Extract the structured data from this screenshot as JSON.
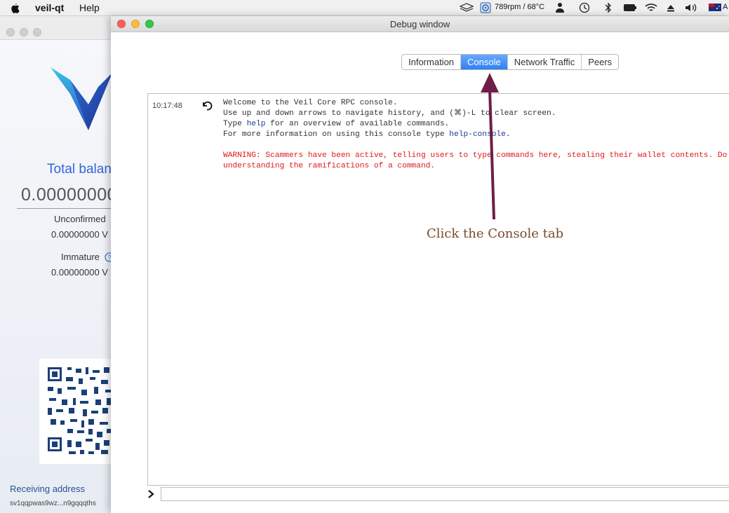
{
  "menubar": {
    "app_name": "veil-qt",
    "help": "Help",
    "cpu_status": "789rpm / 68°C",
    "locale": "A"
  },
  "wallet": {
    "total_label": "Total balan",
    "balance": "0.00000000",
    "unconfirmed_label": "Unconfirmed",
    "unconfirmed_value": "0.00000000 V",
    "immature_label": "Immature",
    "immature_value": "0.00000000 V",
    "receiving_label": "Receiving address",
    "address": "sv1qqpwas9wz...n9gqqqths"
  },
  "debug": {
    "title": "Debug window",
    "tabs": [
      {
        "label": "Information",
        "active": false
      },
      {
        "label": "Console",
        "active": true
      },
      {
        "label": "Network Traffic",
        "active": false
      },
      {
        "label": "Peers",
        "active": false
      }
    ],
    "console": {
      "time": "10:17:48",
      "line1": "Welcome to the Veil Core RPC console.",
      "line2": "Use up and down arrows to navigate history, and (⌘)-L to clear screen.",
      "line3_pre": "Type ",
      "line3_kw": "help",
      "line3_post": " for an overview of available commands.",
      "line4_pre": "For more information on using this console type ",
      "line4_kw": "help-console",
      "line4_post": ".",
      "warning1": "WARNING: Scammers have been active, telling users to type commands here, stealing their wallet contents. Do no",
      "warning2": "understanding the ramifications of a command."
    },
    "input": {
      "value": "",
      "placeholder": ""
    }
  },
  "annotation": {
    "text": "Click the Console tab",
    "color": "#6e1f47"
  }
}
